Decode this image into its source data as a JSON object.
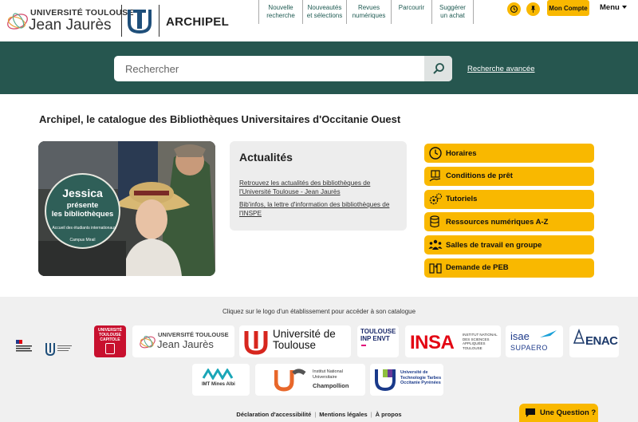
{
  "header": {
    "ut2j_logo": {
      "line1": "UNIVERSITÉ TOULOUSE",
      "line2": "Jean Jaurès"
    },
    "brand": "ARCHIPEL",
    "nav": [
      {
        "label": "Nouvelle recherche"
      },
      {
        "label": "Nouveautés et sélections"
      },
      {
        "label": "Revues numériques"
      },
      {
        "label": "Parcourir"
      },
      {
        "label": "Suggérer un achat"
      }
    ],
    "icons": [
      "history-icon",
      "pin-icon"
    ],
    "account_label": "Mon Compte",
    "menu_label": "Menu"
  },
  "search": {
    "placeholder": "Rechercher",
    "advanced_label": "Recherche avancée"
  },
  "main": {
    "title": "Archipel, le catalogue des Bibliothèques Universitaires d'Occitanie Ouest",
    "promo": {
      "name": "Jessica",
      "line1": "présente",
      "line2": "les bibliothèques",
      "line3": "Accueil des étudiants internationaux",
      "line4": "Campus Mirail"
    },
    "news": {
      "title": "Actualités",
      "items": [
        {
          "label": "Retrouvez les actualités des bibliothèques de l'Université Toulouse - Jean Jaurès"
        },
        {
          "label": "Bib'infos, la lettre d'information des bibliothèques de l'INSPE"
        }
      ]
    },
    "quick_links": [
      {
        "label": "Horaires",
        "icon": "clock-icon"
      },
      {
        "label": "Conditions de prêt",
        "icon": "book-hand-icon"
      },
      {
        "label": "Tutoriels",
        "icon": "gears-icon"
      },
      {
        "label": "Ressources numériques A-Z",
        "icon": "database-icon"
      },
      {
        "label": "Salles de travail en groupe",
        "icon": "group-icon"
      },
      {
        "label": "Demande de PEB",
        "icon": "exchange-icon"
      }
    ]
  },
  "footer": {
    "caption": "Cliquez sur le logo d'un établissement pour accéder à son catalogue",
    "logos": [
      {
        "name": "UNIVERSITÉ TOULOUSE CAPITOLE"
      },
      {
        "name": "UNIVERSITÉ TOULOUSE",
        "sub": "Jean Jaurès"
      },
      {
        "name": "Université de Toulouse"
      },
      {
        "name": "TOULOUSE INP ENVT"
      },
      {
        "name": "INSA",
        "sub": "INSTITUT NATIONAL DES SCIENCES APPLIQUÉES TOULOUSE"
      },
      {
        "name": "isae",
        "sub": "SUPAERO"
      },
      {
        "name": "ENAC"
      },
      {
        "name": "IMT Mines Albi"
      },
      {
        "name": "Institut National Universitaire",
        "sub": "Champollion"
      },
      {
        "name": "Université de Technologie Tarbes Occitanie Pyrénées"
      }
    ],
    "links": [
      "Déclaration d'accessibilité",
      "Mentions légales",
      "À propos"
    ],
    "question_label": "Une Question ?"
  },
  "colors": {
    "primary": "#26564f",
    "accent": "#f9b800",
    "footer_bg": "#f0f0f0"
  }
}
